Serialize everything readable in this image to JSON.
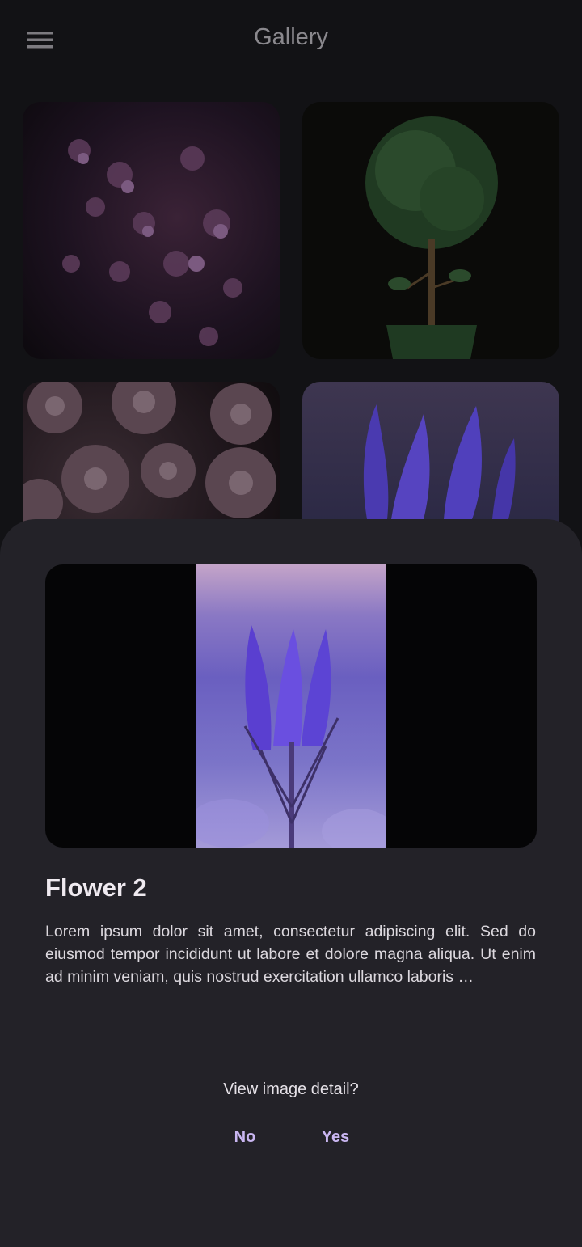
{
  "app_bar": {
    "title": "Gallery",
    "menu_icon": "menu-icon"
  },
  "gallery": {
    "items": [
      {
        "subject": "lilac flowers"
      },
      {
        "subject": "potted topiary tree"
      },
      {
        "subject": "succulents"
      },
      {
        "subject": "purple flower"
      }
    ]
  },
  "sheet": {
    "title": "Flower 2",
    "description": "Lorem ipsum dolor sit amet, consectetur adipiscing elit. Sed do eiusmod tempor incididunt ut labore et dolore magna aliqua. Ut enim ad minim veniam, quis nostrud exercitation ullamco laboris …",
    "prompt": "View image detail?",
    "no_label": "No",
    "yes_label": "Yes"
  },
  "colors": {
    "background": "#121215",
    "sheet": "#232228",
    "accent": "#c9b6f1",
    "title_muted": "#8a888d"
  }
}
